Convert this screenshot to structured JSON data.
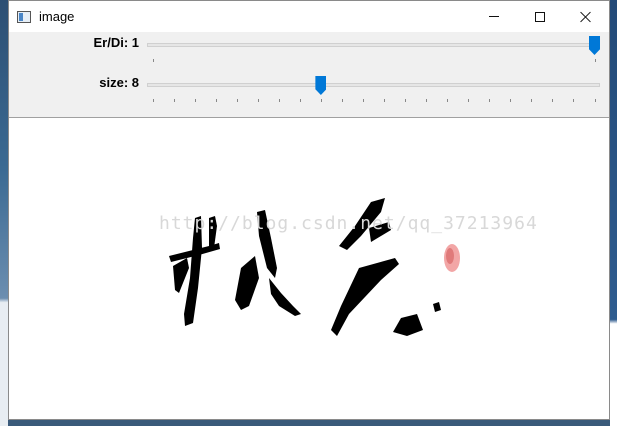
{
  "window": {
    "title": "image",
    "icon": "app-window-icon"
  },
  "trackbars": [
    {
      "label": "Er/Di: 1",
      "value": 1,
      "min": 0,
      "max": 1,
      "ticks": 2
    },
    {
      "label": "size: 8",
      "value": 8,
      "min": 0,
      "max": 21,
      "ticks": 22
    }
  ],
  "image": {
    "watermark": "http://blog.csdn.net/qq_37213964"
  },
  "colors": {
    "thumb": "#0078d7",
    "ink": "#000000",
    "stamp": "#f0a0a0"
  }
}
